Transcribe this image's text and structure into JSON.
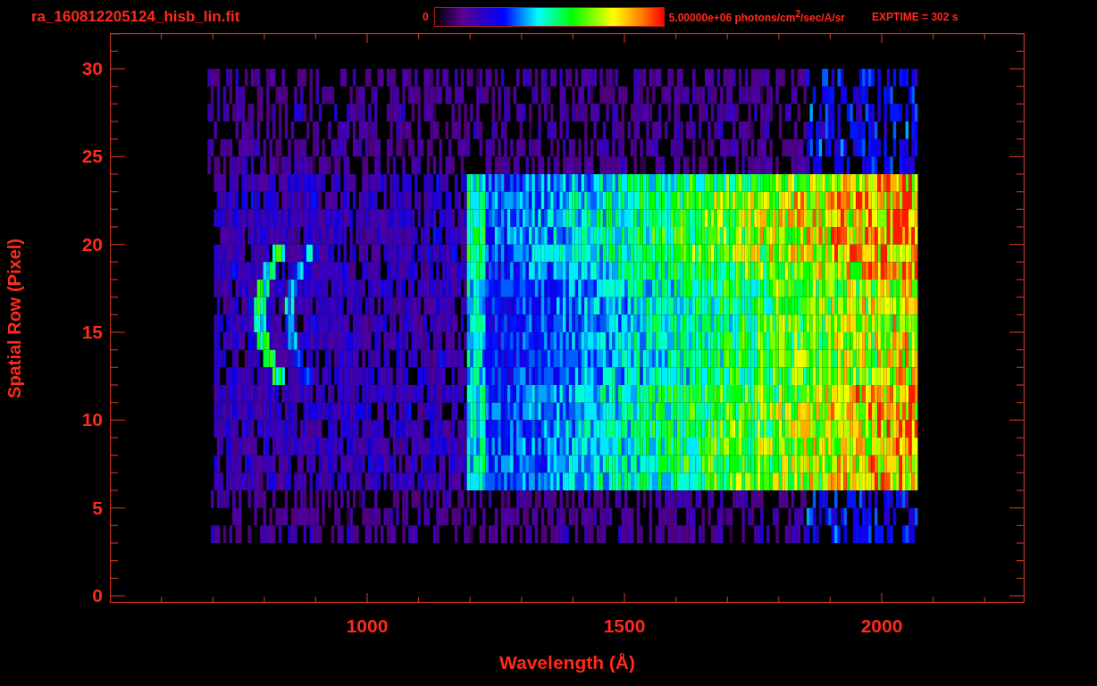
{
  "header": {
    "title": "ra_160812205124_hisb_lin.fit",
    "colorbar": {
      "min_label": "0",
      "max_label": "5.00000e+06 photons/cm$^{2}$/sec/A/sr"
    },
    "exposure": "EXPTIME = 302 s"
  },
  "plot": {
    "x_axis": {
      "label": "Wavelength (Å)",
      "ticks": [
        "1000",
        "1500",
        "2000"
      ]
    },
    "y_axis": {
      "label": "Spatial Row (Pixel)",
      "ticks": [
        "30",
        "25",
        "20",
        "15",
        "10",
        "5",
        "0"
      ]
    }
  }
}
